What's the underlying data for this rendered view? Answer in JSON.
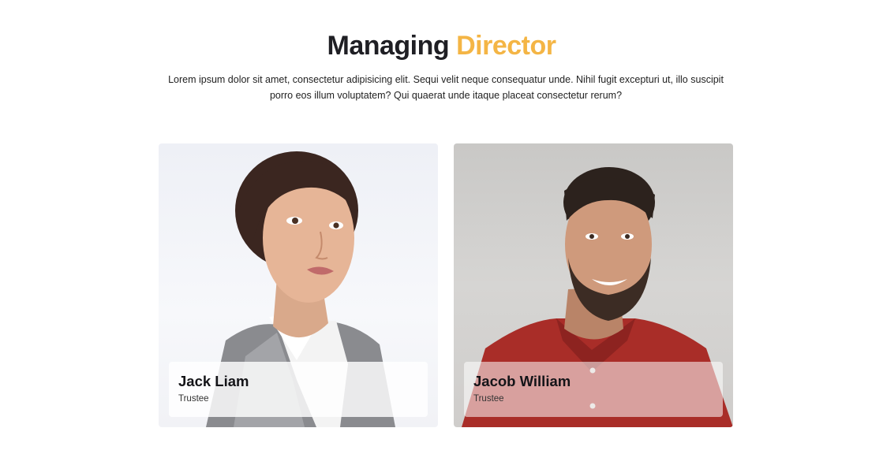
{
  "heading": {
    "title_main": "Managing",
    "title_accent": "Director",
    "intro": "Lorem ipsum dolor sit amet, consectetur adipisicing elit. Sequi velit neque consequatur unde. Nihil fugit excepturi ut, illo suscipit porro eos illum voluptatem? Qui quaerat unde itaque placeat consectetur rerum?"
  },
  "members": [
    {
      "name": "Jack Liam",
      "role": "Trustee"
    },
    {
      "name": "Jacob William",
      "role": "Trustee"
    }
  ],
  "colors": {
    "accent": "#f4b545",
    "heading": "#1f1f24"
  }
}
